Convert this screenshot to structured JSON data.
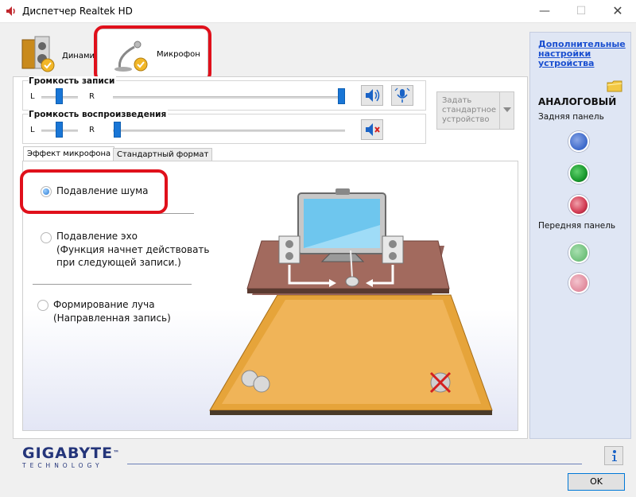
{
  "window": {
    "title": "Диспетчер Realtek HD",
    "minimize": "—",
    "maximize": "☐",
    "close": "✕"
  },
  "device_tabs": [
    {
      "label": "Динамики",
      "icon": "speakers-icon",
      "active": false
    },
    {
      "label": "Микрофон",
      "icon": "microphone-icon",
      "active": true
    }
  ],
  "recording": {
    "title": "Громкость записи",
    "left": "L",
    "right": "R",
    "balance": 0.5,
    "level": 1.0
  },
  "playback": {
    "title": "Громкость воспроизведения",
    "left": "L",
    "right": "R",
    "balance": 0.5,
    "level": 0.0
  },
  "default_device": {
    "label": "Задать стандартное устройство"
  },
  "inner_tabs": [
    {
      "label": "Эффект микрофона",
      "active": true
    },
    {
      "label": "Стандартный формат",
      "active": false
    }
  ],
  "effects": [
    {
      "label": "Подавление шума",
      "checked": true
    },
    {
      "label_lines": [
        "Подавление эхо",
        "(Функция начнет действовать",
        "при следующей записи.)"
      ],
      "checked": false
    },
    {
      "label_lines": [
        "Формирование луча",
        "(Направленная запись)"
      ],
      "checked": false
    }
  ],
  "sidebar": {
    "link_lines": [
      "Дополнительные",
      "настройки",
      "устройства"
    ],
    "analog_label": "АНАЛОГОВЫЙ",
    "rear_label": "Задняя панель",
    "front_label": "Передняя панель",
    "rear_jacks": [
      "#3a67c9",
      "#1a9a2e",
      "#d23a52"
    ],
    "front_jacks": [
      "#6fbf7a",
      "#e08a9c"
    ]
  },
  "logo": {
    "main": "GIGABYTE",
    "sub": "TECHNOLOGY",
    "tm": "™"
  },
  "buttons": {
    "ok": "OK"
  },
  "colors": {
    "accent": "#1976d6",
    "highlight_outline": "#e0101b",
    "link": "#1a4fd0"
  }
}
